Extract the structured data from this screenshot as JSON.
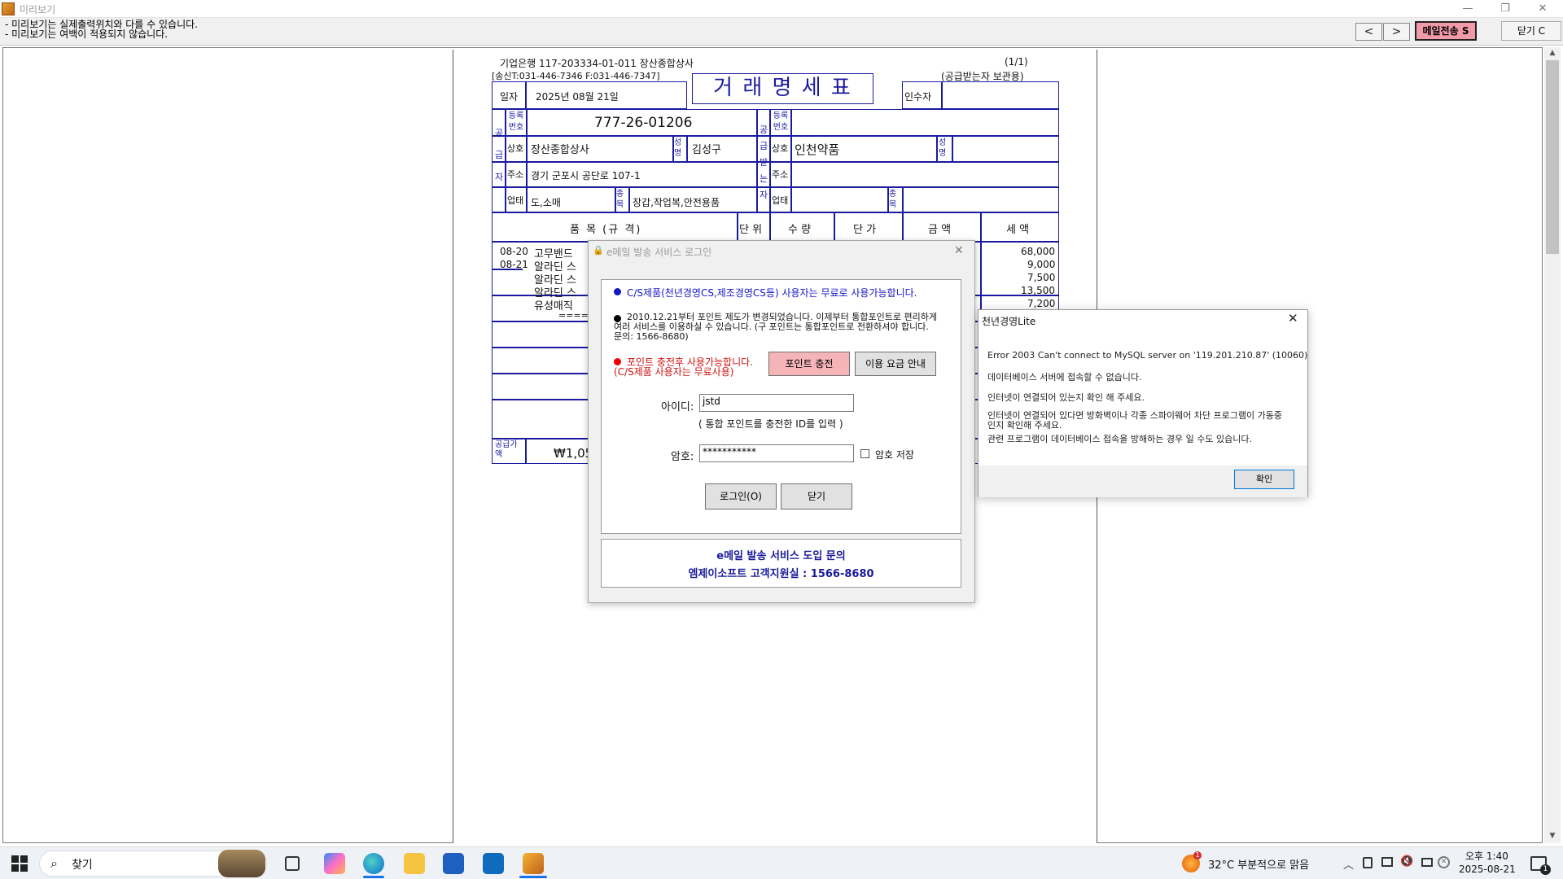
{
  "window": {
    "title": "미리보기",
    "min": "—",
    "restore": "❐",
    "close": "✕"
  },
  "toolbar": {
    "note1": "- 미리보기는 실제출력위치와 다를 수 있습니다.",
    "note2": "- 미리보기는 여백이 적용되지 않습니다.",
    "prev": "<",
    "next": ">",
    "mail_button": "메일전송 S",
    "close_button": "닫기 C"
  },
  "invoice": {
    "bank": "기업은행  117-203334-01-011  장산종합상사",
    "contact": "[송신T:031-446-7346 F:031-446-7347]",
    "page_no": "(1/1)",
    "copy": "(공급받는자 보관용)",
    "title": "거 래 명 세 표",
    "date_label": "일자",
    "date": "2025년  08월  21일",
    "receiver_label": "인수자",
    "reg_label": "등록번호",
    "reg_no": "777-26-01206",
    "name_label": "상호",
    "supplier_name": "장산종합상사",
    "owner_label": "성명",
    "owner": "김성구",
    "addr_label": "주소",
    "address": "경기 군포시 공단로 107-1",
    "biz_label": "업태",
    "biz_type": "도,소매",
    "item_label": "종목",
    "biz_item": "장갑,작업복,안전용품",
    "buyer_name": "인천약품",
    "supplier_side": "공급자",
    "buyer_side": "공급받는자",
    "headers": [
      "품 목 (규 격)",
      "단 위",
      "수 량",
      "단 가",
      "금 액",
      "세 액"
    ],
    "rows": [
      {
        "date": "08-20",
        "item": "고무밴드",
        "tax": "68,000"
      },
      {
        "date": "08-21",
        "item": "알라딘 스",
        "tax": "9,000"
      },
      {
        "date": "",
        "item": "알라딘 스",
        "tax": "7,500"
      },
      {
        "date": "",
        "item": "알라딘 스",
        "tax": "13,500"
      },
      {
        "date": "",
        "item": "유성매직",
        "tax": "7,200"
      }
    ],
    "end_mark": "==== ",
    "total_label": "공급가액",
    "total": "₩1,05"
  },
  "login_dialog": {
    "title": "e메일 발송 서비스 로그인",
    "line1": "C/S제품(천년경영CS,제조경영CS등) 사용자는 무료로 사용가능합니다.",
    "line2": "2010.12.21부터 포인트 제도가 변경되었습니다. 이제부터 통합포인트로 편리하게  여러 서비스를 이용하실 수 있습니다. (구 포인트는 통합포인트로 전환하셔야 합니다. 문의: 1566-8680)",
    "line3a": "포인트 충전후 사용가능합니다.",
    "line3b": "(C/S제품 사용자는 무료사용)",
    "charge_button": "포인트 충전",
    "fee_button": "이용 요금 안내",
    "id_label": "아이디:",
    "id_value": "jstd",
    "id_hint": "( 통합 포인트를 충전한 ID를 입력 )",
    "pw_label": "암호:",
    "pw_value": "***********",
    "save_pw": "암호 저장",
    "login_button": "로그인(O)",
    "close_button": "닫기",
    "footer1": "e메일 발송 서비스 도입 문의",
    "footer2": "엠제이소프트 고객지원실 : 1566-8680"
  },
  "error_dialog": {
    "title": "천년경영Lite",
    "line1": "Error 2003 Can't connect to MySQL server on '119.201.210.87' (10060)",
    "line2": "데이터베이스 서버에 접속할 수 없습니다.",
    "line3": "인터넷이 연결되어 있는지 확인 해 주세요.",
    "line4": "인터넷이 연결되어 있다면 방화벽이나 각종 스파이웨어 차단 프로그램이 가동중인지 확인해 주세요.",
    "line5": "관련 프로그램이 데이터베이스 접속을 방해하는 경우 일 수도 있습니다.",
    "ok": "확인"
  },
  "taskbar": {
    "search": "찾기",
    "weather": "32°C  부분적으로 맑음",
    "time": "오후 1:40",
    "date": "2025-08-21",
    "notif": "1",
    "weather_badge": "1"
  }
}
